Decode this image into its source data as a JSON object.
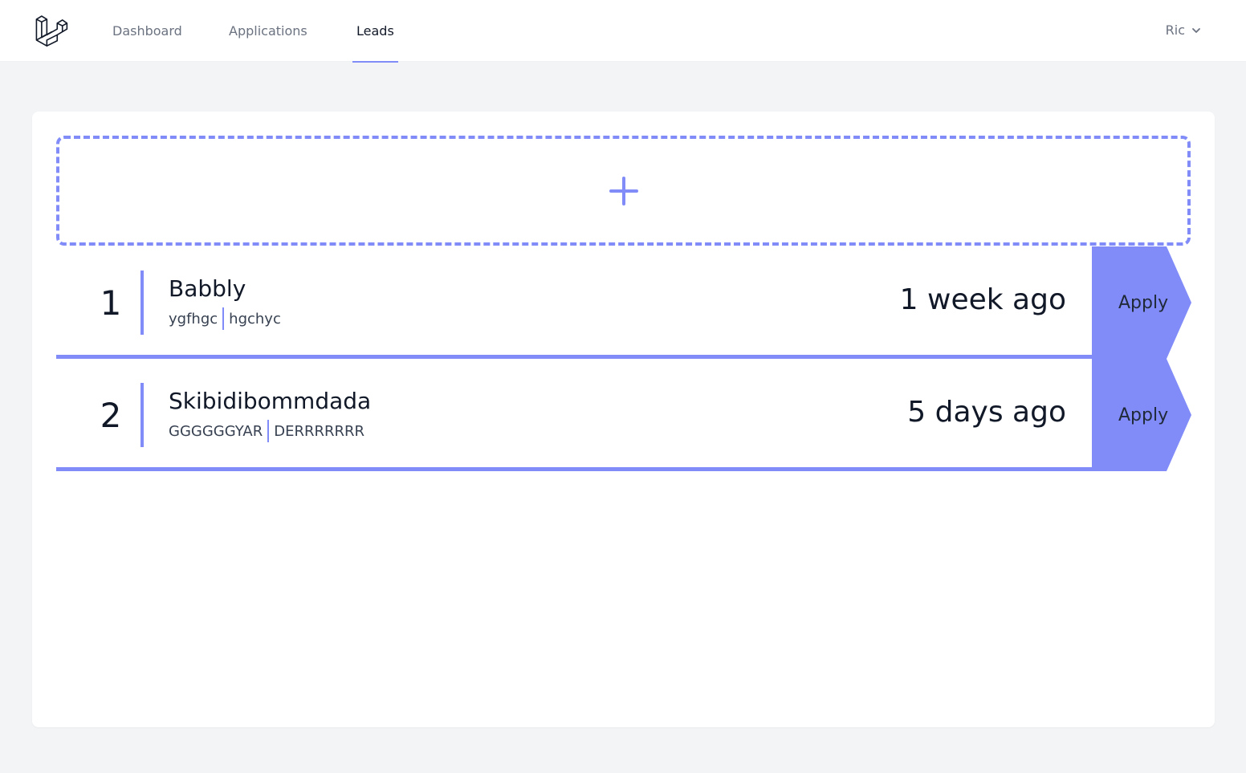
{
  "nav": {
    "links": [
      {
        "label": "Dashboard"
      },
      {
        "label": "Applications"
      },
      {
        "label": "Leads"
      }
    ],
    "active": "Leads",
    "user_name": "Ric"
  },
  "leads": [
    {
      "number": "1",
      "name": "Babbly",
      "meta_a": "ygfhgc",
      "meta_b": "hgchyc",
      "time": "1 week ago",
      "action": "Apply"
    },
    {
      "number": "2",
      "name": "Skibidibommdada",
      "meta_a": "GGGGGGYAR",
      "meta_b": "DERRRRRRR",
      "time": "5 days ago",
      "action": "Apply"
    }
  ],
  "colors": {
    "accent": "#818cf8",
    "background": "#f3f4f6",
    "card": "#ffffff"
  },
  "icons": [
    "laravel-logo-icon",
    "chevron-down-icon",
    "plus-icon"
  ]
}
